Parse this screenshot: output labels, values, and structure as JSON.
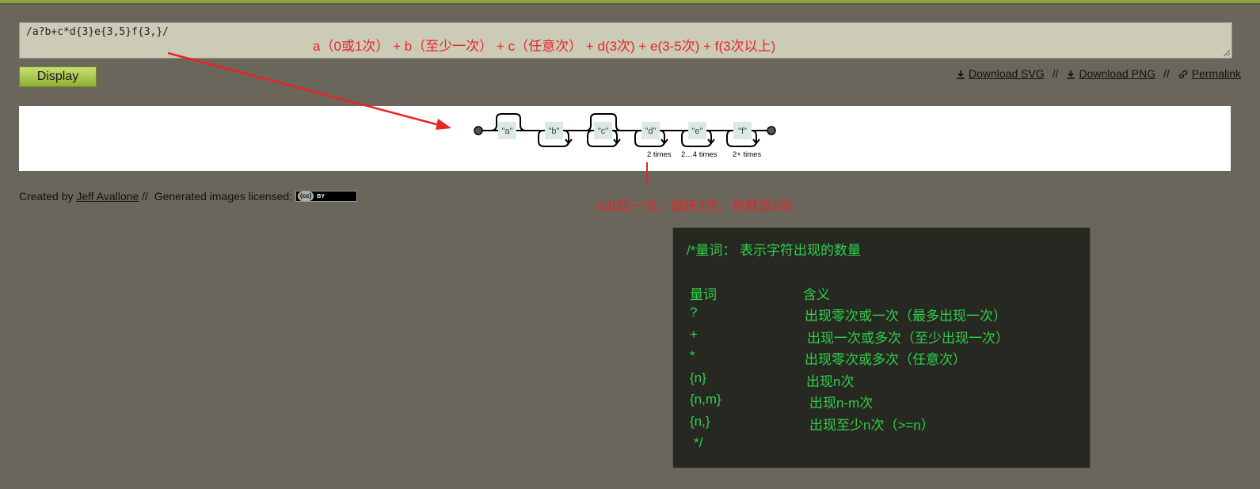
{
  "input": {
    "value": "/a?b+c*d{3}e{3,5}f{3,}/"
  },
  "toolbar": {
    "display_label": "Display",
    "download_svg": "Download SVG",
    "download_png": "Download PNG",
    "permalink": "Permalink",
    "separator": "//"
  },
  "diagram": {
    "nodes": [
      "\"a\"",
      "\"b\"",
      "\"c\"",
      "\"d\"",
      "\"e\"",
      "\"f\""
    ],
    "labels": [
      "2 times",
      "2…4 times",
      "2+ times"
    ]
  },
  "credits": {
    "prefix": "Created by",
    "author": "Jeff Avallone",
    "sep": "//",
    "license_text": "Generated images licensed:",
    "cc": "(cc)",
    "by": "BY"
  },
  "annotations": {
    "top": "a（0或1次） + b（至少一次） + c（任意次） + d(3次) + e(3-5次) + f(3次以上)",
    "d_note": "d出现一次，循环2次，也就是3次"
  },
  "note": {
    "title": "/*量词： 表示字符出现的数量",
    "header": {
      "sym": "量词",
      "mean": "含义"
    },
    "rows": [
      {
        "sym": "?",
        "mean": "出现零次或一次（最多出现一次）"
      },
      {
        "sym": "+",
        "mean": "出现一次或多次（至少出现一次）"
      },
      {
        "sym": "*",
        "mean": "出现零次或多次（任意次）"
      },
      {
        "sym": "{n}",
        "mean": "出现n次"
      },
      {
        "sym": "{n,m}",
        "mean": "出现n-m次"
      },
      {
        "sym": "{n,}",
        "mean": "出现至少n次（>=n）"
      }
    ],
    "end": "*/"
  },
  "colors": {
    "background": "#6b665b",
    "accent_bar": "#8aa63a",
    "annotation": "#e82424",
    "note_text": "#2ed14a",
    "note_bg": "#272822"
  }
}
